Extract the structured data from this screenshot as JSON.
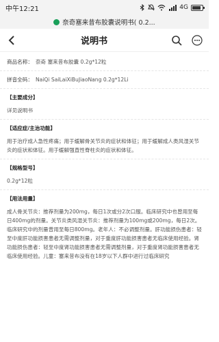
{
  "status_bar": {
    "time": "中午12:21",
    "signal_label": "4G"
  },
  "url_bar": {
    "title": "奈奇塞来昔布胶囊说明书( 0.2..."
  },
  "nav": {
    "title": "说明书"
  },
  "content": {
    "product_name_label": "商品名称：",
    "product_name_value": "奈奇 塞来昔布胶囊 0.2g*12粒",
    "pinyin_label": "拼音全码：",
    "pinyin_value": "NaiQi SaiLaiXiBuJiaoNang 0.2g*12Li",
    "section_ingredients": "【主要成分】",
    "ingredients_text": "详见说明书",
    "section_indications": "【适应症/主治功能】",
    "indications_text": "用于治疗成人急性疼痛；用于缓解骨关节炎的症状和体征；用于缓解成人类风湿关节炎的症状和体征。用于缓解强直性脊柱炎的症状和体征。",
    "section_spec": "【规格型号】",
    "spec_text": "0.2g*12粒",
    "section_usage": "【用法用量】",
    "usage_text": "成人骨关节炎：推荐剂量为200mg，每日1次或分2次口服。临床研究中也曾用至每日400mg的剂量。关节炎类风湿关节炎：推荐剂量为100mg或200mg，每日2次。临床研究中的剂量曾用至每日800mg。老年人：不必调整剂量。肝功能损伤患者：轻至中度肝功能损害患者无需调整剂量，对于重度肝功能损害患者无临床使用经验。肾功能损伤患者：轻至中度肾功能损害患者无需调整剂量，对于重度肾功能损害患者无临床使用经验。儿童：塞来昔布没有在18岁以下人群中进行过临床研究"
  }
}
